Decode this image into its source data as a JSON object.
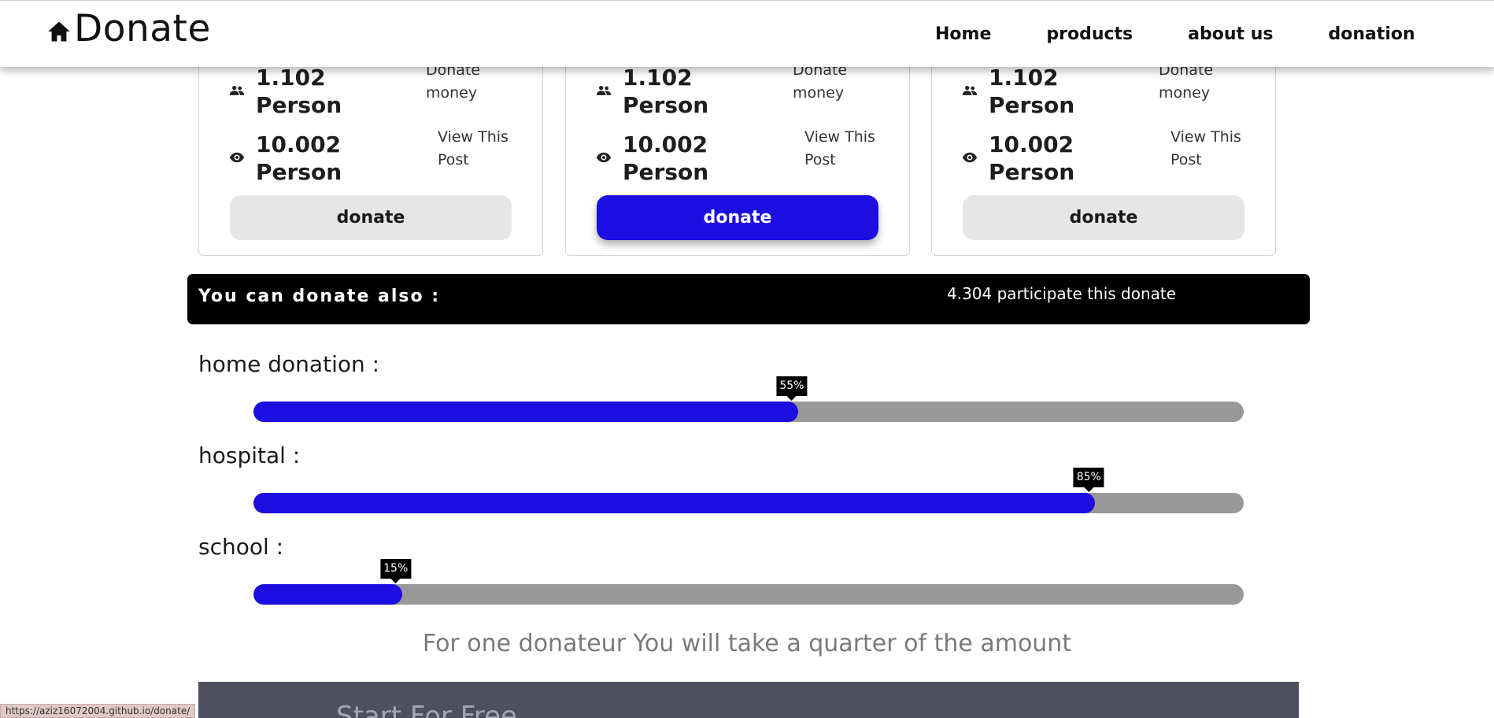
{
  "brand": {
    "name": "Donate",
    "icon": "home-icon"
  },
  "nav": {
    "items": [
      {
        "label": "Home"
      },
      {
        "label": "products"
      },
      {
        "label": "about us"
      },
      {
        "label": "donation"
      }
    ]
  },
  "cards": [
    {
      "donors_value": "1.102 Person",
      "donors_caption": "Donate money",
      "donors_icon": "people-icon",
      "views_value": "10.002 Person",
      "views_caption": "View This Post",
      "views_icon": "eye-icon",
      "button_label": "donate",
      "button_active": false
    },
    {
      "donors_value": "1.102 Person",
      "donors_caption": "Donate money",
      "donors_icon": "people-icon",
      "views_value": "10.002 Person",
      "views_caption": "View This Post",
      "views_icon": "eye-icon",
      "button_label": "donate",
      "button_active": true
    },
    {
      "donors_value": "1.102 Person",
      "donors_caption": "Donate money",
      "donors_icon": "people-icon",
      "views_value": "10.002 Person",
      "views_caption": "View This Post",
      "views_icon": "eye-icon",
      "button_label": "donate",
      "button_active": false
    }
  ],
  "banner": {
    "left_text": "You can donate also :",
    "right_text": "4.304 participate this donate"
  },
  "progress": [
    {
      "label": "home donation :",
      "percent": 55,
      "percent_label": "55%"
    },
    {
      "label": "hospital :",
      "percent": 85,
      "percent_label": "85%"
    },
    {
      "label": "school :",
      "percent": 15,
      "percent_label": "15%"
    }
  ],
  "note": "For one donateur You will take a quarter of the amount",
  "cta": {
    "text": "Start For Free"
  },
  "status_bar": {
    "url": "https://aziz16072004.github.io/donate/"
  },
  "colors": {
    "accent": "#1c0ee0",
    "track": "#999999",
    "banner": "#000000",
    "cta_bg": "#4e5060"
  }
}
